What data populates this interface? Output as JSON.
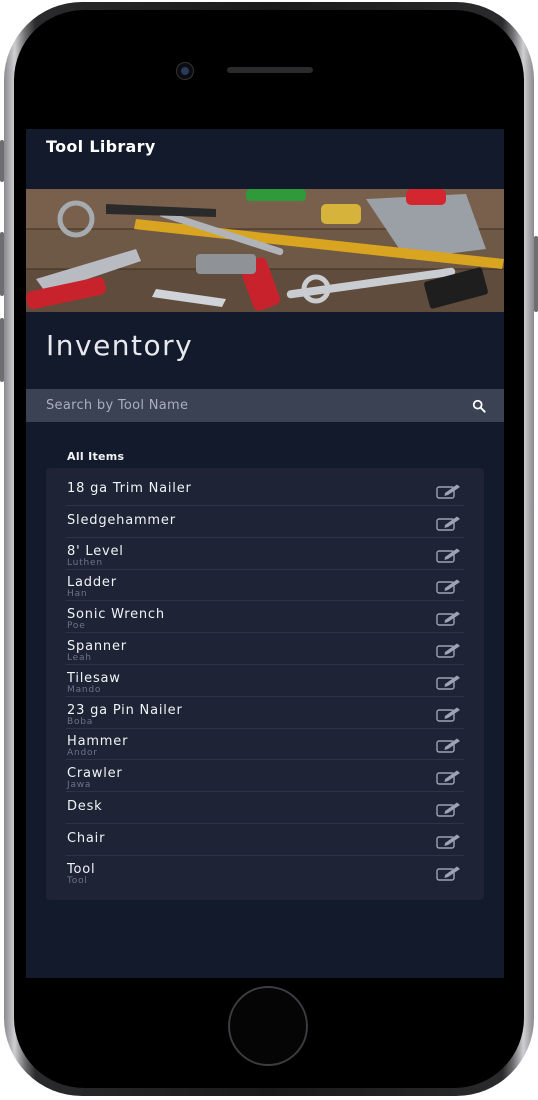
{
  "app": {
    "title": "Tool Library"
  },
  "banner": {
    "alt": ""
  },
  "page": {
    "heading": "Inventory"
  },
  "search": {
    "placeholder": "Search by Tool Name",
    "value": ""
  },
  "list": {
    "section_label": "All Items",
    "items": [
      {
        "name": "18 ga Trim Nailer",
        "owner": ""
      },
      {
        "name": "Sledgehammer",
        "owner": ""
      },
      {
        "name": "8' Level",
        "owner": "Luthen"
      },
      {
        "name": "Ladder",
        "owner": "Han"
      },
      {
        "name": "Sonic Wrench",
        "owner": "Poe"
      },
      {
        "name": "Spanner",
        "owner": "Leah"
      },
      {
        "name": "Tilesaw",
        "owner": "Mando"
      },
      {
        "name": "23 ga Pin Nailer",
        "owner": "Boba"
      },
      {
        "name": "Hammer",
        "owner": "Andor"
      },
      {
        "name": "Crawler",
        "owner": "Jawa"
      },
      {
        "name": "Desk",
        "owner": ""
      },
      {
        "name": "Chair",
        "owner": ""
      },
      {
        "name": "Tool",
        "owner": "Tool"
      }
    ]
  },
  "colors": {
    "screen_bg": "#121a2b",
    "list_bg": "#1e2436",
    "search_bg": "#3a4254",
    "text": "#f2f3f6",
    "muted": "#6b7386"
  },
  "icons": {
    "search": "search-icon",
    "edit": "edit-icon"
  }
}
